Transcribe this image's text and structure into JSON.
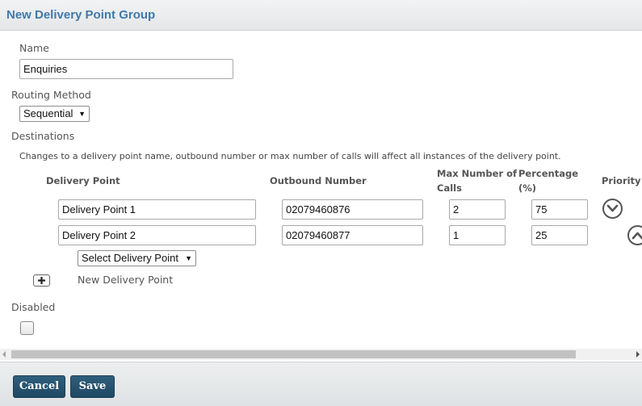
{
  "header": {
    "title": "New Delivery Point Group"
  },
  "form": {
    "name_label": "Name",
    "name_value": "Enquiries",
    "routing_label": "Routing Method",
    "routing_value": "Sequential",
    "destinations_label": "Destinations",
    "note": "Changes to a delivery point name, outbound number or max number of calls will affect all instances of the delivery point.",
    "columns": {
      "delivery_point": "Delivery Point",
      "outbound_number": "Outbound Number",
      "max_calls_line1": "Max Number of",
      "max_calls_line2": "Calls",
      "percentage_line1": "Percentage",
      "percentage_line2": "(%)",
      "priority": "Priority"
    },
    "rows": [
      {
        "delivery_point": "Delivery Point 1",
        "outbound_number": "02079460876",
        "max_calls": "2",
        "percentage": "75",
        "priority_icon": "chevron-down-icon"
      },
      {
        "delivery_point": "Delivery Point 2",
        "outbound_number": "02079460877",
        "max_calls": "1",
        "percentage": "25",
        "priority_icon": "chevron-up-icon"
      }
    ],
    "select_delivery_point": "Select Delivery Point",
    "new_delivery_point": "New Delivery Point",
    "disabled_label": "Disabled",
    "disabled_checked": false
  },
  "footer": {
    "cancel_label": "Cancel",
    "save_label": "Save"
  },
  "colors": {
    "title": "#3f79ab",
    "button": "#1f4863"
  }
}
